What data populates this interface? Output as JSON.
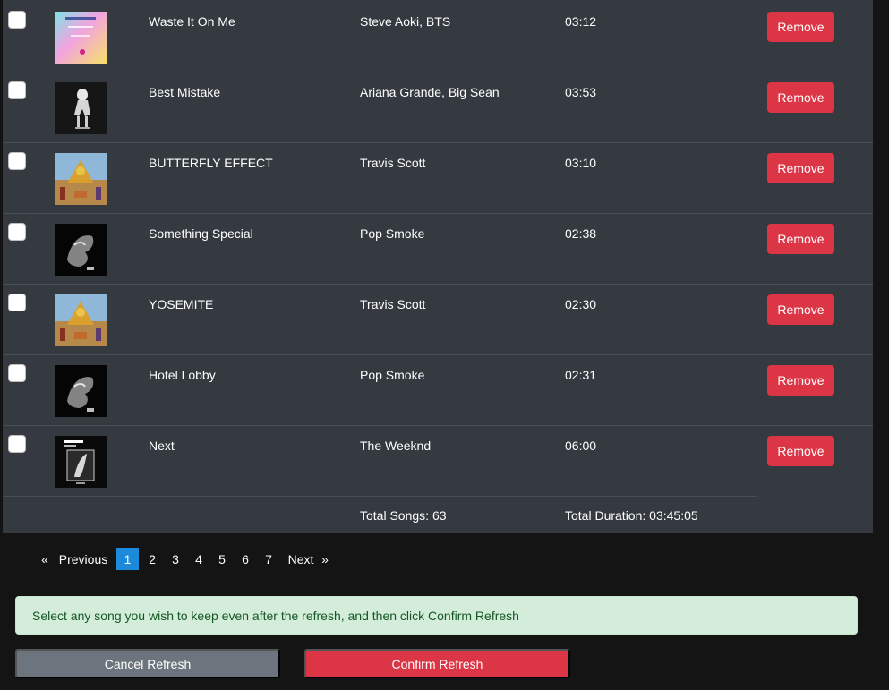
{
  "songs": [
    {
      "title": "Waste It On Me",
      "artist": "Steve Aoki, BTS",
      "duration": "03:12",
      "remove_label": "Remove",
      "art": "steve-aoki-album-art"
    },
    {
      "title": "Best Mistake",
      "artist": "Ariana Grande, Big Sean",
      "duration": "03:53",
      "remove_label": "Remove",
      "art": "ariana-grande-album-art"
    },
    {
      "title": "BUTTERFLY EFFECT",
      "artist": "Travis Scott",
      "duration": "03:10",
      "remove_label": "Remove",
      "art": "astroworld-album-art"
    },
    {
      "title": "Something Special",
      "artist": "Pop Smoke",
      "duration": "02:38",
      "remove_label": "Remove",
      "art": "pop-smoke-album-art"
    },
    {
      "title": "YOSEMITE",
      "artist": "Travis Scott",
      "duration": "02:30",
      "remove_label": "Remove",
      "art": "astroworld-album-art"
    },
    {
      "title": "Hotel Lobby",
      "artist": "Pop Smoke",
      "duration": "02:31",
      "remove_label": "Remove",
      "art": "pop-smoke-album-art"
    },
    {
      "title": "Next",
      "artist": "The Weeknd",
      "duration": "06:00",
      "remove_label": "Remove",
      "art": "the-weeknd-album-art"
    }
  ],
  "footer": {
    "total_songs": "Total Songs: 63",
    "total_duration": "Total Duration: 03:45:05"
  },
  "pagination": {
    "prev_arrow": "«",
    "prev_label": "Previous",
    "pages": [
      "1",
      "2",
      "3",
      "4",
      "5",
      "6",
      "7"
    ],
    "current_page": "1",
    "next_label": "Next",
    "next_arrow": "»"
  },
  "alert": {
    "message": "Select any song you wish to keep even after the refresh, and then click Confirm Refresh"
  },
  "actions": {
    "cancel_label": "Cancel Refresh",
    "confirm_label": "Confirm Refresh"
  },
  "colors": {
    "table_bg": "#343a40",
    "page_bg": "#141414",
    "danger": "#dc3545",
    "secondary": "#6c757d",
    "active_page": "#1c8adb",
    "alert_bg": "#d4edda",
    "alert_text": "#155724"
  }
}
